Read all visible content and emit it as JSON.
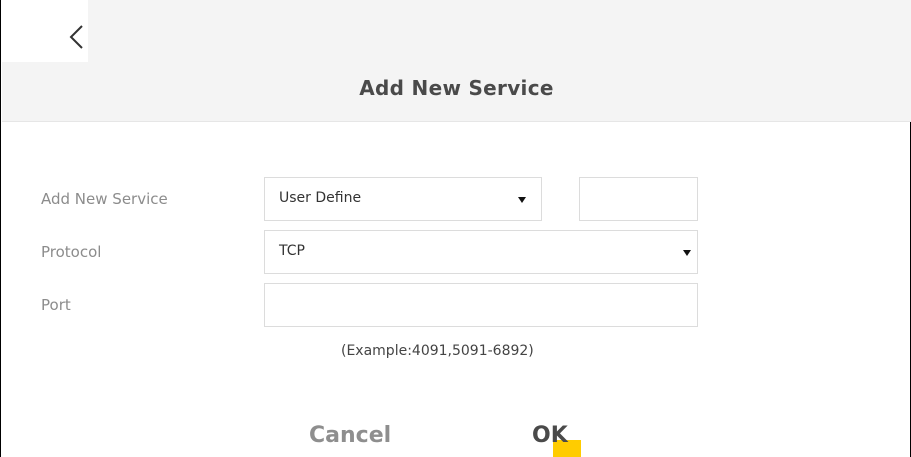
{
  "header": {
    "back_icon": "chevron-left-icon",
    "title": "Add New Service"
  },
  "form": {
    "service": {
      "label": "Add New Service",
      "selected": "User Define",
      "custom_value": ""
    },
    "protocol": {
      "label": "Protocol",
      "selected": "TCP"
    },
    "port": {
      "label": "Port",
      "value": "",
      "hint": "(Example:4091,5091-6892)"
    }
  },
  "actions": {
    "cancel_label": "Cancel",
    "ok_label": "OK"
  },
  "colors": {
    "header_bg": "#f4f4f4",
    "accent": "#ffcc00"
  }
}
